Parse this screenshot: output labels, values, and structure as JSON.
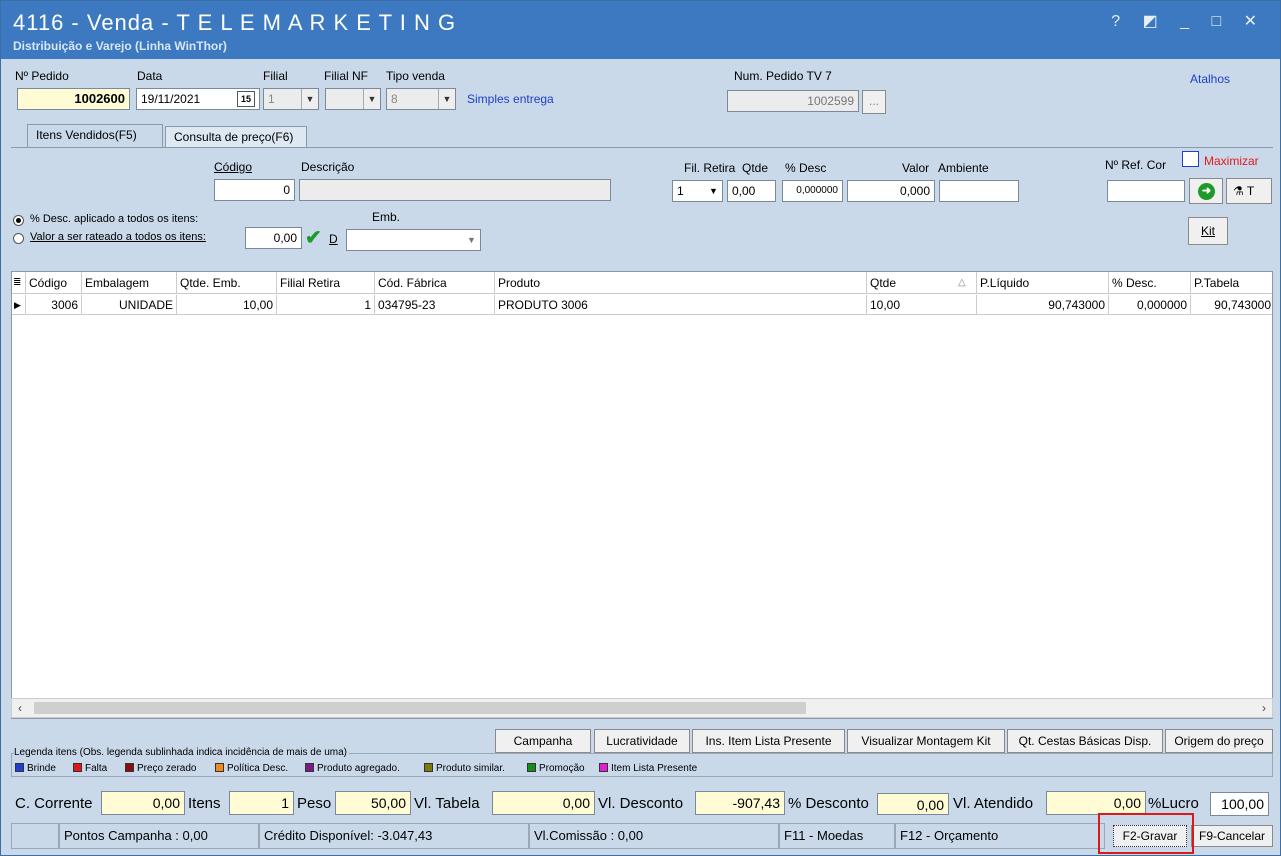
{
  "window": {
    "title": "4116 - Venda - T E L E M A R K E T I N G",
    "subtitle": "Distribuição e Varejo (Linha WinThor)",
    "controls": "? ◩ _ □ ✕"
  },
  "header": {
    "pedido_label": "Nº Pedido",
    "pedido": "1002600",
    "data_label": "Data",
    "data": "19/11/2021",
    "cal_icon": "15",
    "filial_label": "Filial",
    "filial": "1",
    "filial_nf_label": "Filial NF",
    "filial_nf": "",
    "tipo_venda_label": "Tipo venda",
    "tipo_venda": "8",
    "tipo_venda_desc": "Simples entrega",
    "num_tv7_label": "Num. Pedido TV 7",
    "num_tv7": "1002599",
    "dots": "...",
    "atalhos": "Atalhos"
  },
  "tabs": [
    "Itens Vendidos(F5)",
    "Consulta de preço(F6)"
  ],
  "item": {
    "codigo_label": "Código",
    "codigo": "0",
    "descricao_label": "Descrição",
    "descricao": "",
    "fil_retira_label": "Fil. Retira",
    "fil_retira": "1",
    "qtde_label": "Qtde",
    "qtde": "0,00",
    "desc_label": "% Desc",
    "desc": "0,000000",
    "valor_label": "Valor",
    "valor": "0,000",
    "ambiente_label": "Ambiente",
    "ambiente": "",
    "nref_label": "Nº Ref. Cor",
    "nref": "",
    "maximizar": "Maximizar",
    "t_label": "T",
    "kit": "Kit",
    "radio1": "% Desc. aplicado a todos os itens:",
    "radio2": "Valor a ser rateado a todos os itens:",
    "rateio": "0,00",
    "d_label": "D",
    "emb_label": "Emb.",
    "emb": ""
  },
  "grid": {
    "headers": [
      "Código",
      "Embalagem",
      "Qtde. Emb.",
      "Filial Retira",
      "Cód. Fábrica",
      "Produto",
      "Qtde",
      "P.Líquido",
      "% Desc.",
      "P.Tabela"
    ],
    "rows": [
      {
        "codigo": "3006",
        "embalagem": "UNIDADE",
        "qtde_emb": "10,00",
        "filial_retira": "1",
        "cod_fabrica": "034795-23",
        "produto": "PRODUTO 3006",
        "qtde": "10,00",
        "p_liquido": "90,743000",
        "desc": "0,000000",
        "p_tabela": "90,743000"
      }
    ]
  },
  "actions": [
    "Campanha",
    "Lucratividade",
    "Ins. Item Lista Presente",
    "Visualizar Montagem Kit",
    "Qt. Cestas Básicas Disp.",
    "Origem do preço"
  ],
  "legend": {
    "title": "Legenda itens (Obs. legenda sublinhada indica incidência de mais de uma)",
    "items": [
      {
        "label": "Brinde",
        "color": "#1f3fd0"
      },
      {
        "label": "Falta",
        "color": "#e01818"
      },
      {
        "label": "Preço zerado",
        "color": "#8a0e0e"
      },
      {
        "label": "Política Desc.",
        "color": "#f08a1a"
      },
      {
        "label": "Produto agregado.",
        "color": "#7a1a8a"
      },
      {
        "label": "Produto similar.",
        "color": "#7a7a10"
      },
      {
        "label": "Promoção",
        "color": "#1a8a1a"
      },
      {
        "label": "Item Lista Presente",
        "color": "#e020d0"
      }
    ]
  },
  "totals": {
    "c_corrente_label": "C. Corrente",
    "c_corrente": "0,00",
    "itens_label": "Itens",
    "itens": "1",
    "peso_label": "Peso",
    "peso": "50,00",
    "vl_tabela_label": "Vl. Tabela",
    "vl_tabela": "0,00",
    "vl_desconto_label": "Vl. Desconto",
    "vl_desconto": "-907,43",
    "pct_desconto_label": "% Desconto",
    "pct_desconto": "0,00",
    "vl_atendido_label": "Vl. Atendido",
    "vl_atendido": "0,00",
    "pct_lucro_label": "%Lucro",
    "pct_lucro": "100,00"
  },
  "status": {
    "pontos": "Pontos Campanha : 0,00",
    "credito": "Crédito Disponível: -3.047,43",
    "comissao": "Vl.Comissão : 0,00",
    "f11": "F11 - Moedas",
    "f12": "F12 - Orçamento",
    "gravar": "F2-Gravar",
    "cancelar": "F9-Cancelar"
  }
}
